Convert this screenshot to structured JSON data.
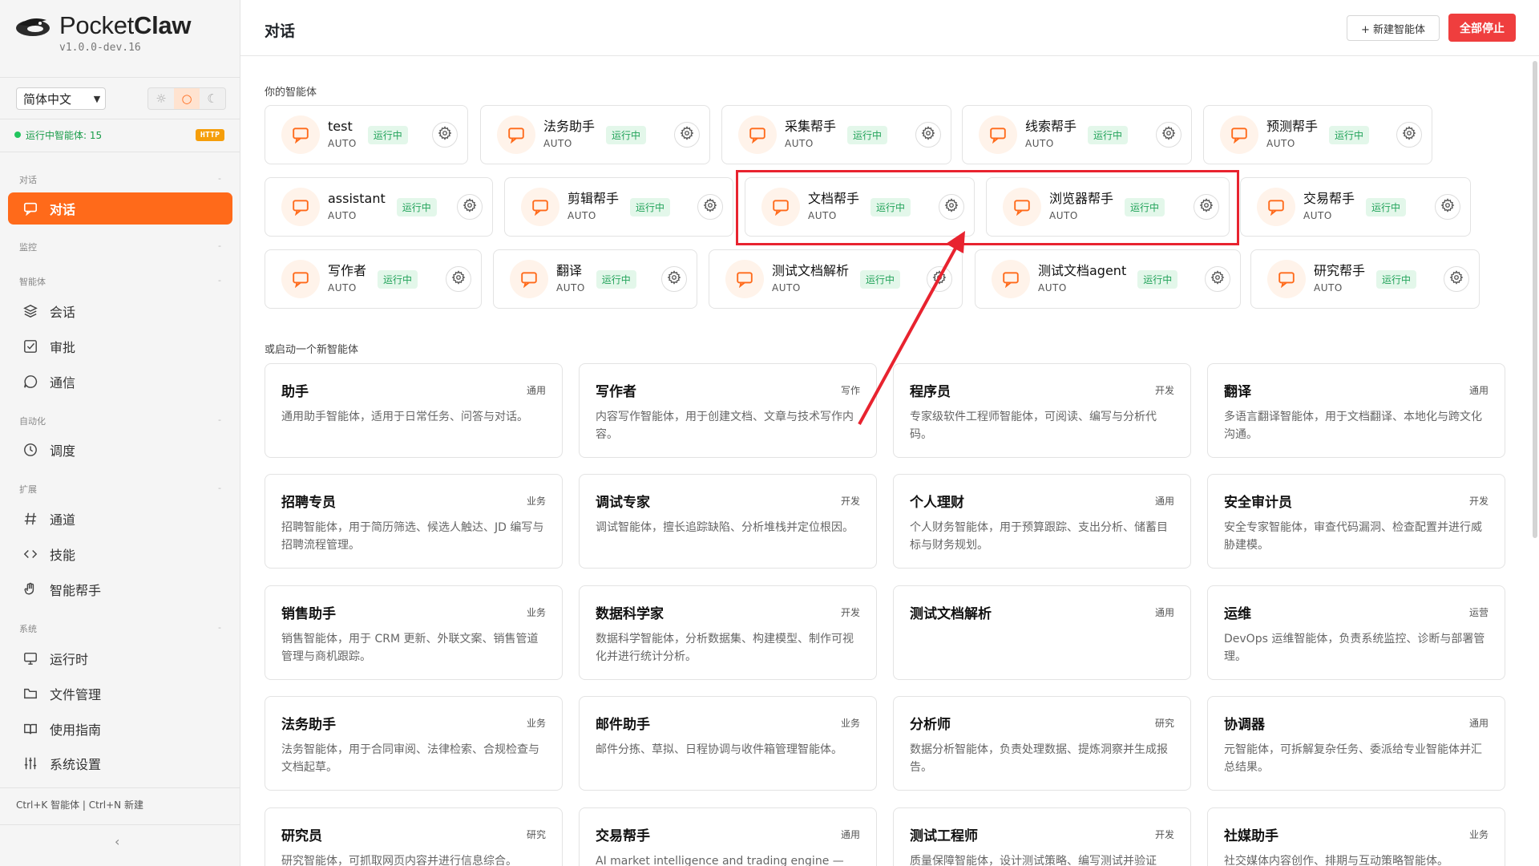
{
  "app": {
    "name_light": "Pocket",
    "name_bold": "Claw",
    "version": "v1.0.0-dev.16"
  },
  "sidebar": {
    "language": "简体中文",
    "theme_icons": [
      "sun-icon",
      "circle-icon",
      "moon-icon"
    ],
    "status_text": "运行中智能体: 15",
    "connection_badge": "HTTP",
    "sections": {
      "chat": "对话",
      "monitor": "监控",
      "agents": "智能体",
      "automation": "自动化",
      "extensions": "扩展",
      "system": "系统"
    },
    "items": {
      "chat": "对话",
      "sessions": "会话",
      "approvals": "审批",
      "comms": "通信",
      "scheduler": "调度",
      "channels": "通道",
      "skills": "技能",
      "helper": "智能帮手",
      "runtime": "运行时",
      "files": "文件管理",
      "guide": "使用指南",
      "settings": "系统设置"
    },
    "shortcut_hint": "Ctrl+K 智能体 | Ctrl+N 新建"
  },
  "header": {
    "title": "对话",
    "new_agent_label": "+ 新建智能体",
    "stop_all_label": "全部停止"
  },
  "agents": {
    "section_title": "你的智能体",
    "status_label": "运行中",
    "mode_label": "AUTO",
    "list": [
      {
        "name": "test"
      },
      {
        "name": "法务助手"
      },
      {
        "name": "采集帮手"
      },
      {
        "name": "线索帮手"
      },
      {
        "name": "预测帮手"
      },
      {
        "name": "assistant"
      },
      {
        "name": "剪辑帮手"
      },
      {
        "name": "文档帮手"
      },
      {
        "name": "浏览器帮手"
      },
      {
        "name": "交易帮手"
      },
      {
        "name": "写作者"
      },
      {
        "name": "翻译"
      },
      {
        "name": "测试文档解析"
      },
      {
        "name": "测试文档agent"
      },
      {
        "name": "研究帮手"
      }
    ]
  },
  "templates": {
    "section_title": "或启动一个新智能体",
    "list": [
      {
        "name": "助手",
        "tag": "通用",
        "desc": "通用助手智能体，适用于日常任务、问答与对话。"
      },
      {
        "name": "写作者",
        "tag": "写作",
        "desc": "内容写作智能体，用于创建文档、文章与技术写作内容。"
      },
      {
        "name": "程序员",
        "tag": "开发",
        "desc": "专家级软件工程师智能体，可阅读、编写与分析代码。"
      },
      {
        "name": "翻译",
        "tag": "通用",
        "desc": "多语言翻译智能体，用于文档翻译、本地化与跨文化沟通。"
      },
      {
        "name": "招聘专员",
        "tag": "业务",
        "desc": "招聘智能体，用于简历筛选、候选人触达、JD 编写与招聘流程管理。"
      },
      {
        "name": "调试专家",
        "tag": "开发",
        "desc": "调试智能体，擅长追踪缺陷、分析堆栈并定位根因。"
      },
      {
        "name": "个人理财",
        "tag": "通用",
        "desc": "个人财务智能体，用于预算跟踪、支出分析、储蓄目标与财务规划。"
      },
      {
        "name": "安全审计员",
        "tag": "开发",
        "desc": "安全专家智能体，审查代码漏洞、检查配置并进行威胁建模。"
      },
      {
        "name": "销售助手",
        "tag": "业务",
        "desc": "销售智能体，用于 CRM 更新、外联文案、销售管道管理与商机跟踪。"
      },
      {
        "name": "数据科学家",
        "tag": "开发",
        "desc": "数据科学智能体，分析数据集、构建模型、制作可视化并进行统计分析。"
      },
      {
        "name": "测试文档解析",
        "tag": "通用",
        "desc": ""
      },
      {
        "name": "运维",
        "tag": "运营",
        "desc": "DevOps 运维智能体，负责系统监控、诊断与部署管理。"
      },
      {
        "name": "法务助手",
        "tag": "业务",
        "desc": "法务智能体，用于合同审阅、法律检索、合规检查与文档起草。"
      },
      {
        "name": "邮件助手",
        "tag": "业务",
        "desc": "邮件分拣、草拟、日程协调与收件箱管理智能体。"
      },
      {
        "name": "分析师",
        "tag": "研究",
        "desc": "数据分析智能体，负责处理数据、提炼洞察并生成报告。"
      },
      {
        "name": "协调器",
        "tag": "通用",
        "desc": "元智能体，可拆解复杂任务、委派给专业智能体并汇总结果。"
      },
      {
        "name": "研究员",
        "tag": "研究",
        "desc": "研究智能体，可抓取网页内容并进行信息综合。"
      },
      {
        "name": "交易帮手",
        "tag": "通用",
        "desc": "AI market intelligence and trading engine — multi-"
      },
      {
        "name": "测试工程师",
        "tag": "开发",
        "desc": "质量保障智能体，设计测试策略、编写测试并验证"
      },
      {
        "name": "社媒助手",
        "tag": "业务",
        "desc": "社交媒体内容创作、排期与互动策略智能体。"
      }
    ]
  },
  "colors": {
    "accent": "#ff6a1a",
    "danger": "#ef3e3e",
    "running_green": "#22a35a",
    "annotation_red": "#e8232f"
  }
}
